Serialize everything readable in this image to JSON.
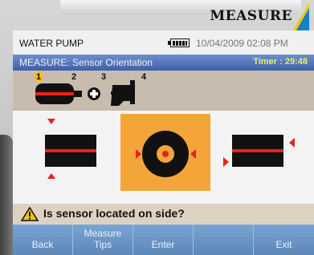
{
  "banner": {
    "text": "MEASURE"
  },
  "titlebar": {
    "app_title": "WATER PUMP",
    "datetime": "10/04/2009 02:08 PM"
  },
  "header": {
    "title": "MEASURE: Sensor Orientation",
    "timer": "Timer : 29:48"
  },
  "selector": {
    "steps": [
      "1",
      "2",
      "3",
      "4"
    ],
    "active_step": "1"
  },
  "orientations": [
    {
      "name": "top-bottom"
    },
    {
      "name": "side",
      "selected": true
    },
    {
      "name": "opposite-side"
    }
  ],
  "question": {
    "text": "Is sensor located on side?"
  },
  "function_keys": [
    {
      "line1": "Back",
      "line2": ""
    },
    {
      "line1": "Measure",
      "line2": "Tips"
    },
    {
      "line1": "Enter",
      "line2": ""
    },
    {
      "line1": "",
      "line2": ""
    },
    {
      "line1": "Exit",
      "line2": ""
    }
  ],
  "colors": {
    "header": "#3e5fa8",
    "timer": "#e7f25a",
    "highlight": "#f4a53a",
    "fkeys": "#6a95c6",
    "marker": "#e5231b"
  }
}
